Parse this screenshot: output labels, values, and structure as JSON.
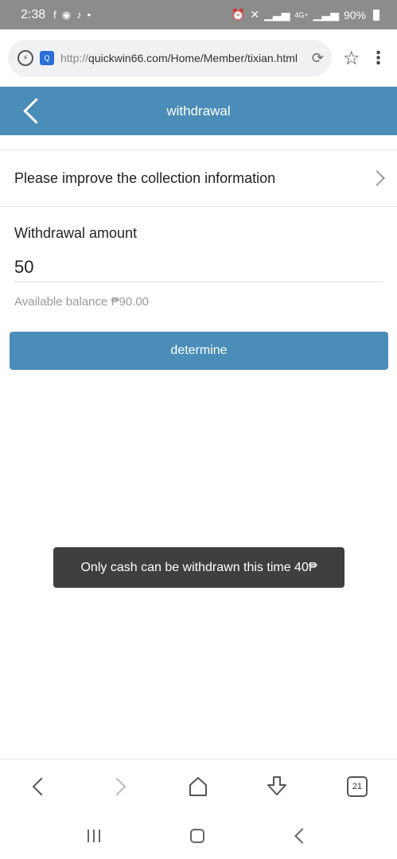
{
  "status_bar": {
    "time": "2:38",
    "left_icons": [
      "facebook-icon",
      "messenger-icon",
      "tiktok-icon",
      "dot-icon"
    ],
    "right_icons": [
      "alarm-icon",
      "mute-icon",
      "signal-icon",
      "lte-signal-icon"
    ],
    "network": "4G+",
    "battery": "90%"
  },
  "browser": {
    "url_protocol": "http://",
    "url_rest": "quickwin66.com/Home/Member/tixian.html",
    "tab_count": "21"
  },
  "header": {
    "title": "withdrawal"
  },
  "collection": {
    "label": "Please improve the collection information"
  },
  "withdrawal": {
    "amount_label": "Withdrawal amount",
    "amount_value": "50",
    "balance_text": "Available balance ₱90.00",
    "button_label": "determine"
  },
  "toast": {
    "message": "Only cash can be withdrawn this time 40₱"
  }
}
